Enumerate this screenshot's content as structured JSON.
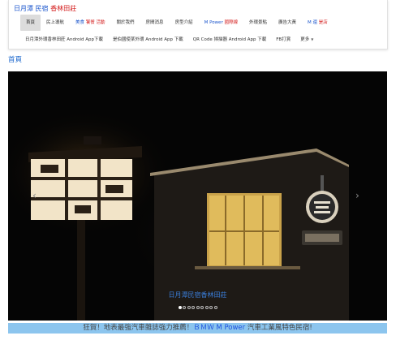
{
  "brand": {
    "part1": "日月潭 民宿",
    "part2": "香林田莊"
  },
  "nav_primary": [
    {
      "label": "首頁",
      "active": true
    },
    {
      "label": "民上導航"
    },
    {
      "label": "美食 饕餮 活動",
      "style": "colored"
    },
    {
      "label": "關於我們"
    },
    {
      "label": "房間消息"
    },
    {
      "label": "房型介紹"
    },
    {
      "label": "M Power 國際線",
      "style": "mpower"
    },
    {
      "label": "外環景點"
    },
    {
      "label": "廣告大黃"
    },
    {
      "label": "M 還 是店",
      "style": "mstore"
    }
  ],
  "nav_secondary": [
    {
      "label": "日月潭外環香林田莊 Android App下載"
    },
    {
      "label": "是伯國使某外環 Android App 下載"
    },
    {
      "label": "QR Code 掃描器 Android App 下載"
    },
    {
      "label": "FB打賞"
    },
    {
      "label": "更多",
      "has_caret": true
    }
  ],
  "breadcrumb": "首頁",
  "hero": {
    "caption": "日月潭民宿香林田莊",
    "slide_count": 9,
    "active_slide": 0,
    "prev_glyph": "‹",
    "next_glyph": "›"
  },
  "banner": {
    "prefix": "狂賀！地表最強汽車雜誌強力推薦！",
    "highlight": "ＢＭＷ M Power",
    "suffix": " 汽車工業風特色民宿!"
  },
  "colors": {
    "link_blue": "#1a55cc",
    "accent_red": "#d42020",
    "banner_bg": "#8cc5ee"
  }
}
